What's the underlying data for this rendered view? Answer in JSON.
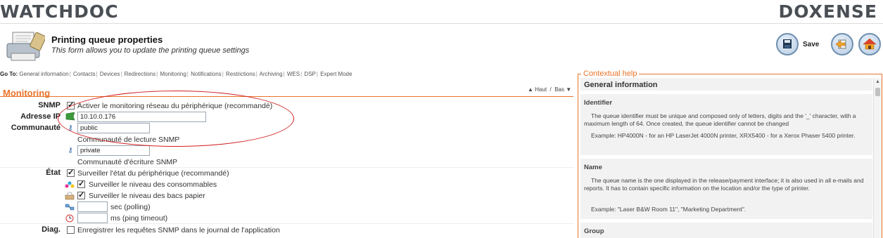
{
  "brand": {
    "left_logo": "WATCHDOC",
    "right_logo": "DOXENSE"
  },
  "header": {
    "title": "Printing queue properties",
    "subtitle": "This form allows you to update the printing queue settings",
    "save_label": "Save"
  },
  "goto": {
    "label": "Go To:",
    "links": [
      "General information",
      "Contacts",
      "Devices",
      "Redirections",
      "Monitoring",
      "Notifications",
      "Restrictions",
      "Archiving",
      "WES",
      "DSP",
      "Expert Mode"
    ]
  },
  "nav_updown": {
    "up": "▲ Haut",
    "sep": "/",
    "down": "Bas ▼"
  },
  "section": {
    "title": "Monitoring"
  },
  "form": {
    "snmp": {
      "label": "SNMP",
      "checkbox_text": "Activer le monitoring réseau du périphérique (recommandé)",
      "checked": true
    },
    "ip": {
      "label": "Adresse IP",
      "value": "10.10.0.176"
    },
    "community": {
      "label": "Communauté",
      "read_value": "public",
      "read_caption": "Communauté de lecture SNMP",
      "write_value": "private",
      "write_caption": "Communauté d'écriture SNMP"
    },
    "state": {
      "label": "État",
      "device_text": "Surveiller l'état du périphérique (recommandé)",
      "consumables_text": "Surveiller le niveau des consommables",
      "trays_text": "Surveiller le niveau des bacs papier",
      "polling_value": "",
      "polling_unit": "sec (polling)",
      "ping_value": "",
      "ping_unit": "ms (ping timeout)"
    },
    "diag": {
      "label": "Diag.",
      "checkbox_text": "Enregistrer les requêtes SNMP dans le journal de l'application",
      "checked": false
    }
  },
  "help": {
    "legend": "Contextual help",
    "heading": "General information",
    "sections": [
      {
        "title": "Identifier",
        "body": "The queue identifier must be unique and composed only of letters, digits and the '_' character, with a maximum length of 64. Once created, the queue identifier cannot be changed",
        "example": "Example: HP4000N - for an HP LaserJet 4000N printer, XRX5400 - for a Xerox Phaser 5400 printer."
      },
      {
        "title": "Name",
        "body": "The queue name is the one displayed in the release/payment interface; it is also used in all e-mails and reports. It has to contain specific information on the location and/or the type of printer.",
        "example": "Example: \"Laser B&W Room 11\", \"Marketing Department\"."
      },
      {
        "title": "Group"
      }
    ]
  }
}
